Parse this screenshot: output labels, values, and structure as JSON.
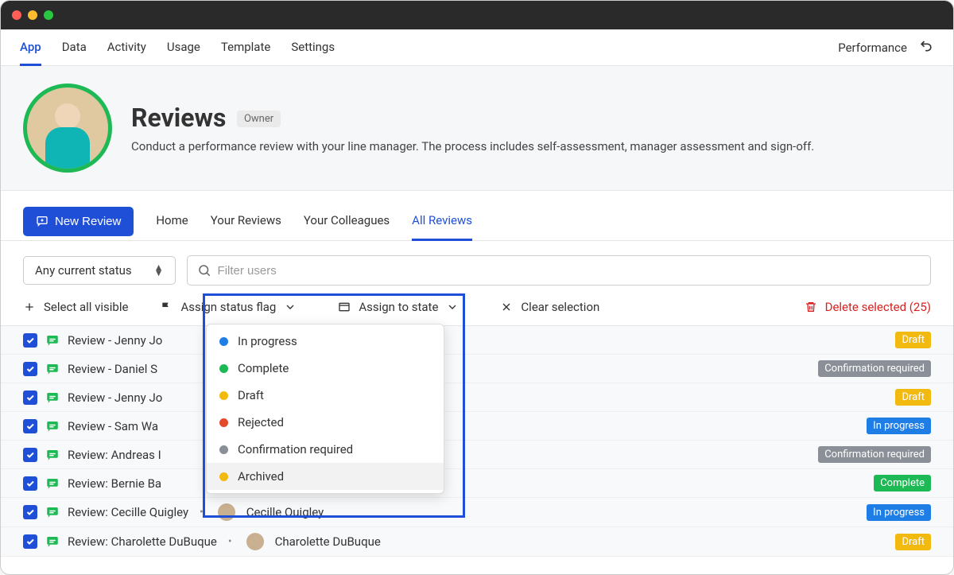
{
  "topnav": {
    "items": [
      "App",
      "Data",
      "Activity",
      "Usage",
      "Template",
      "Settings"
    ],
    "active_index": 0,
    "right_label": "Performance"
  },
  "header": {
    "title": "Reviews",
    "badge": "Owner",
    "description": "Conduct a performance review with your line manager. The process includes self-assessment, manager assessment and sign-off."
  },
  "subnav": {
    "button_label": "New Review",
    "items": [
      "Home",
      "Your Reviews",
      "Your Colleagues",
      "All Reviews"
    ],
    "active_index": 3
  },
  "filters": {
    "status_select": "Any current status",
    "search_placeholder": "Filter users"
  },
  "actions": {
    "select_all": "Select all visible",
    "assign_flag": "Assign status flag",
    "assign_state": "Assign to state",
    "clear": "Clear selection",
    "delete": "Delete selected (25)"
  },
  "dropdown": {
    "items": [
      {
        "label": "In progress",
        "color": "#1f7de6",
        "hover": false
      },
      {
        "label": "Complete",
        "color": "#1db954",
        "hover": false
      },
      {
        "label": "Draft",
        "color": "#f2b90f",
        "hover": false
      },
      {
        "label": "Rejected",
        "color": "#e24a2b",
        "hover": false
      },
      {
        "label": "Confirmation required",
        "color": "#8a8f98",
        "hover": false
      },
      {
        "label": "Archived",
        "color": "#f2b90f",
        "hover": true
      }
    ]
  },
  "status_colors": {
    "Draft": "#f2b90f",
    "Confirmation required": "#8a8f98",
    "In progress": "#1f7de6",
    "Complete": "#1db954"
  },
  "rows": [
    {
      "title": "Review - Jenny Jo",
      "assignee": null,
      "status": "Draft"
    },
    {
      "title": "Review - Daniel S",
      "assignee": null,
      "status": "Confirmation required"
    },
    {
      "title": "Review - Jenny Jo",
      "assignee": null,
      "status": "Draft"
    },
    {
      "title": "Review - Sam Wa",
      "assignee": null,
      "status": "In progress"
    },
    {
      "title": "Review: Andreas I",
      "assignee": null,
      "status": "Confirmation required"
    },
    {
      "title": "Review: Bernie Ba",
      "assignee": null,
      "status": "Complete"
    },
    {
      "title": "Review: Cecille Quigley",
      "assignee": "Cecille Quigley",
      "status": "In progress"
    },
    {
      "title": "Review: Charolette DuBuque",
      "assignee": "Charolette DuBuque",
      "status": "Draft"
    }
  ]
}
